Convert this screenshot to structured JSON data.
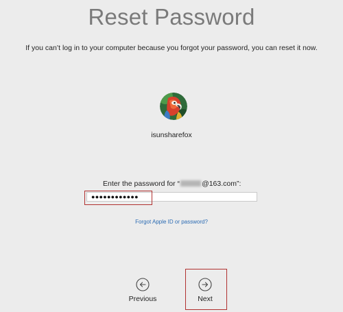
{
  "header": {
    "title": "Reset Password",
    "description": "If you can’t log in to your computer because you forgot your password, you can reset it now."
  },
  "user": {
    "username": "isunsharefox",
    "avatar_icon": "parrot-avatar"
  },
  "password": {
    "prompt_prefix": "Enter the password for “",
    "prompt_suffix": "@163.com”:",
    "masked_value": "●●●●●●●●●●●●"
  },
  "links": {
    "forgot": "Forgot Apple ID or password?"
  },
  "navigation": {
    "previous_label": "Previous",
    "previous_icon": "arrow-left-circle-icon",
    "next_label": "Next",
    "next_icon": "arrow-right-circle-icon"
  },
  "colors": {
    "background": "#ececec",
    "title": "#7a7a7a",
    "link": "#2b6bb3",
    "highlight": "#b0302f"
  }
}
